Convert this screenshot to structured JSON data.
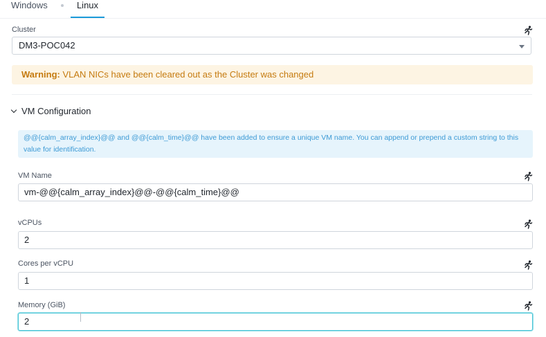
{
  "tabs": {
    "windows": "Windows",
    "linux": "Linux",
    "active": "Linux"
  },
  "cluster": {
    "label": "Cluster",
    "value": "DM3-POC042"
  },
  "warning": {
    "prefix": "Warning:",
    "message": "VLAN NICs have been cleared out as the Cluster was changed"
  },
  "section": {
    "title": "VM Configuration",
    "expanded": true
  },
  "info": {
    "line1": "@@{calm_array_index}@@ and @@{calm_time}@@ have been added to ensure a unique VM name. You can append or prepend a custom string to this",
    "line2": "value for identification."
  },
  "fields": {
    "vm_name": {
      "label": "VM Name",
      "value": "vm-@@{calm_array_index}@@-@@{calm_time}@@"
    },
    "vcpus": {
      "label": "vCPUs",
      "value": "2"
    },
    "cores": {
      "label": "Cores per vCPU",
      "value": "1"
    },
    "memory": {
      "label": "Memory (GiB)",
      "value": "2"
    }
  },
  "icons": {
    "runtime": "running-person-icon"
  },
  "colors": {
    "accent": "#1b9ad9",
    "warning_bg": "#fdf4e3",
    "warning_text": "#c57b10",
    "info_bg": "#e6f4fc",
    "info_text": "#3d9ad5",
    "focus_border": "#47c4d6"
  }
}
